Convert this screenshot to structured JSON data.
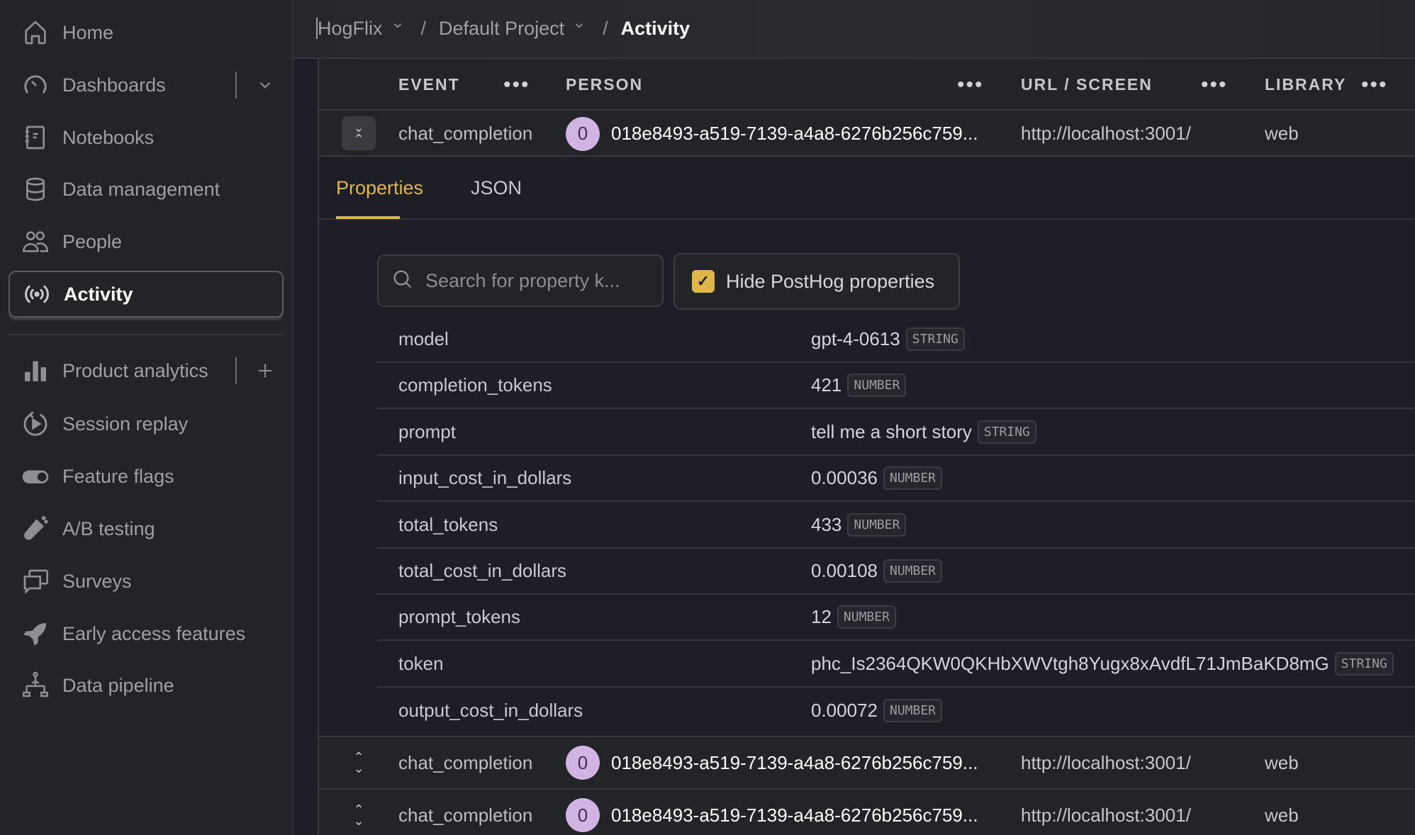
{
  "sidebar": {
    "items": [
      {
        "label": "Home",
        "icon": "home-icon"
      },
      {
        "label": "Dashboards",
        "icon": "dashboard-gauge-icon",
        "side": "chevron-down-icon"
      },
      {
        "label": "Notebooks",
        "icon": "notebook-icon"
      },
      {
        "label": "Data management",
        "icon": "database-icon"
      },
      {
        "label": "People",
        "icon": "people-icon"
      },
      {
        "label": "Activity",
        "icon": "broadcast-icon",
        "active": true
      },
      {
        "label": "Product analytics",
        "icon": "bar-chart-icon",
        "side": "plus-icon"
      },
      {
        "label": "Session replay",
        "icon": "replay-icon"
      },
      {
        "label": "Feature flags",
        "icon": "toggle-icon"
      },
      {
        "label": "A/B testing",
        "icon": "flask-icon"
      },
      {
        "label": "Surveys",
        "icon": "chat-bubbles-icon"
      },
      {
        "label": "Early access features",
        "icon": "rocket-icon"
      },
      {
        "label": "Data pipeline",
        "icon": "pipeline-icon"
      }
    ]
  },
  "breadcrumb": {
    "org": "HogFlix",
    "project": "Default Project",
    "current": "Activity",
    "separator": "/"
  },
  "table": {
    "columns": [
      "EVENT",
      "PERSON",
      "URL / SCREEN",
      "LIBRARY"
    ],
    "column_menu": "•••",
    "rows": [
      {
        "event": "chat_completion",
        "avatar": "0",
        "person": "018e8493-a519-7139-a4a8-6276b256c759...",
        "url": "http://localhost:3001/",
        "library": "web",
        "expanded": true
      },
      {
        "event": "chat_completion",
        "avatar": "0",
        "person": "018e8493-a519-7139-a4a8-6276b256c759...",
        "url": "http://localhost:3001/",
        "library": "web",
        "expanded": false
      },
      {
        "event": "chat_completion",
        "avatar": "0",
        "person": "018e8493-a519-7139-a4a8-6276b256c759...",
        "url": "http://localhost:3001/",
        "library": "web",
        "expanded": false
      }
    ]
  },
  "details": {
    "tabs": [
      "Properties",
      "JSON"
    ],
    "active_tab": "Properties",
    "search_placeholder": "Search for property k...",
    "hide_posthog_label": "Hide PostHog properties",
    "hide_posthog_checked": true,
    "properties": [
      {
        "key": "model",
        "value": "gpt-4-0613",
        "type": "STRING"
      },
      {
        "key": "completion_tokens",
        "value": "421",
        "type": "NUMBER"
      },
      {
        "key": "prompt",
        "value": "tell me a short story",
        "type": "STRING"
      },
      {
        "key": "input_cost_in_dollars",
        "value": "0.00036",
        "type": "NUMBER"
      },
      {
        "key": "total_tokens",
        "value": "433",
        "type": "NUMBER"
      },
      {
        "key": "total_cost_in_dollars",
        "value": "0.00108",
        "type": "NUMBER"
      },
      {
        "key": "prompt_tokens",
        "value": "12",
        "type": "NUMBER"
      },
      {
        "key": "token",
        "value": "phc_Is2364QKW0QKHbXWVtgh8Yugx8xAvdfL71JmBaKD8mG",
        "type": "STRING"
      },
      {
        "key": "output_cost_in_dollars",
        "value": "0.00072",
        "type": "NUMBER"
      }
    ]
  },
  "colors": {
    "accent": "#e0b549",
    "avatar_bg": "#d2b4e4",
    "background": "#1e1f26",
    "surface": "#232428"
  }
}
